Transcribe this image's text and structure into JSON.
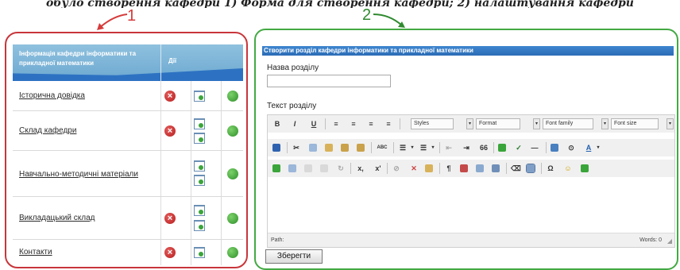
{
  "caption": "обуло створення кафедри 1) Форма для створення кафедри; 2) налаштування кафедри",
  "callouts": {
    "one": "1",
    "two": "2"
  },
  "left_panel": {
    "header_title": "Інформація кафедри інформатики та прикладної математики",
    "header_actions": "Дії",
    "rows": [
      {
        "label": "Історична довідка",
        "delete": true,
        "pages": 1
      },
      {
        "label": "Склад кафедри",
        "delete": true,
        "pages": 2
      },
      {
        "label": "Навчально-методичні матеріали",
        "delete": false,
        "pages": 2
      },
      {
        "label": "Викладацький склад",
        "delete": true,
        "pages": 2
      },
      {
        "label": "Контакти",
        "delete": true,
        "pages": 1
      }
    ]
  },
  "right_panel": {
    "title": "Створити розділ кафедри інформатики та прикладної математики",
    "name_label": "Назва розділу",
    "name_value": "",
    "text_label": "Текст розділу",
    "toolbar": {
      "bold": "B",
      "italic": "I",
      "underline": "U",
      "styles": "Styles",
      "format": "Format",
      "font_family": "Font family",
      "font_size": "Font size",
      "abc": "ABC",
      "quote": "66",
      "text_color": "A",
      "subscript": "x,",
      "superscript": "x'",
      "pilcrow": "¶",
      "omega": "Ω"
    },
    "status": {
      "path": "Path:",
      "words": "Words: 0"
    },
    "save": "Зберегти"
  },
  "colors": {
    "left_border": "#c8363b",
    "right_border": "#43a943",
    "header_blue": "#2d72c2",
    "ok_green": "#2f8f2a",
    "delete_red": "#b81f1f"
  }
}
